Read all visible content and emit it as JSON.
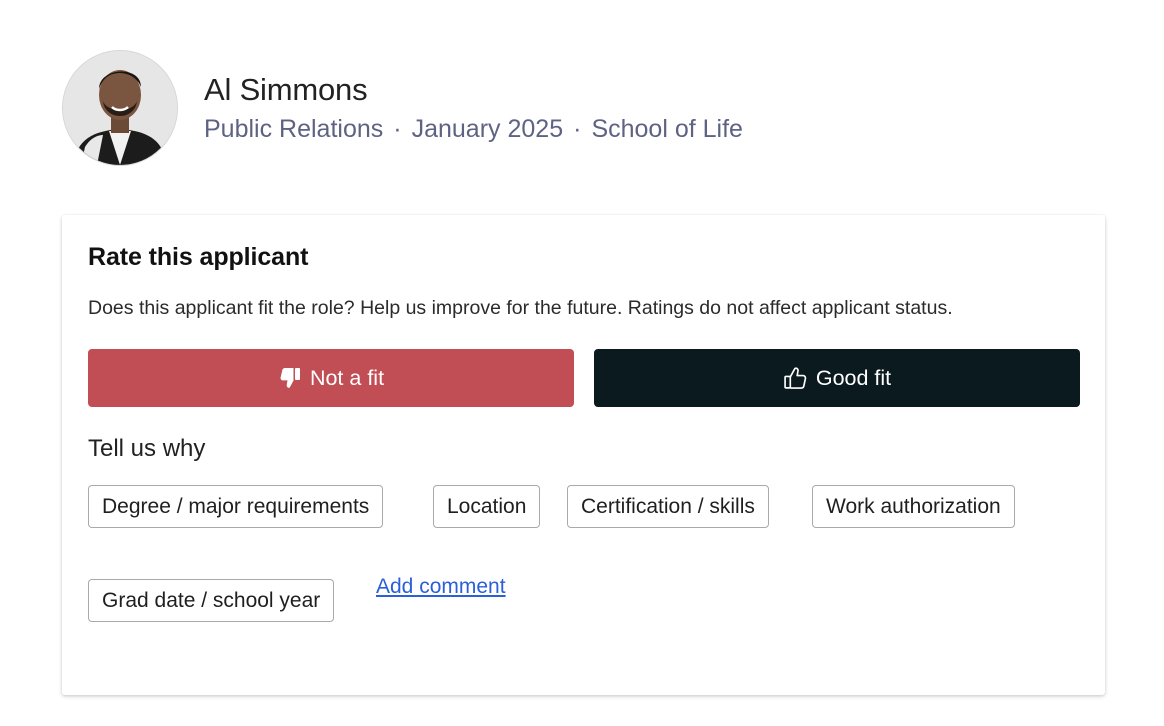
{
  "applicant": {
    "name": "Al Simmons",
    "field": "Public Relations",
    "grad_date": "January 2025",
    "school": "School of Life",
    "separator": "·"
  },
  "rating": {
    "title": "Rate this applicant",
    "description": "Does this applicant fit the role? Help us improve for the future. Ratings do not affect applicant status.",
    "not_fit_label": "Not a fit",
    "good_fit_label": "Good fit",
    "not_fit_color": "#c24e55",
    "good_fit_color": "#0b1a1e"
  },
  "reasons": {
    "heading": "Tell us why",
    "chips": [
      "Degree / major requirements",
      "Location",
      "Certification / skills",
      "Work authorization",
      "Grad date / school year"
    ],
    "add_comment_label": "Add comment"
  },
  "icons": {
    "not_fit": "thumbs-down-icon",
    "good_fit": "thumbs-up-icon"
  }
}
